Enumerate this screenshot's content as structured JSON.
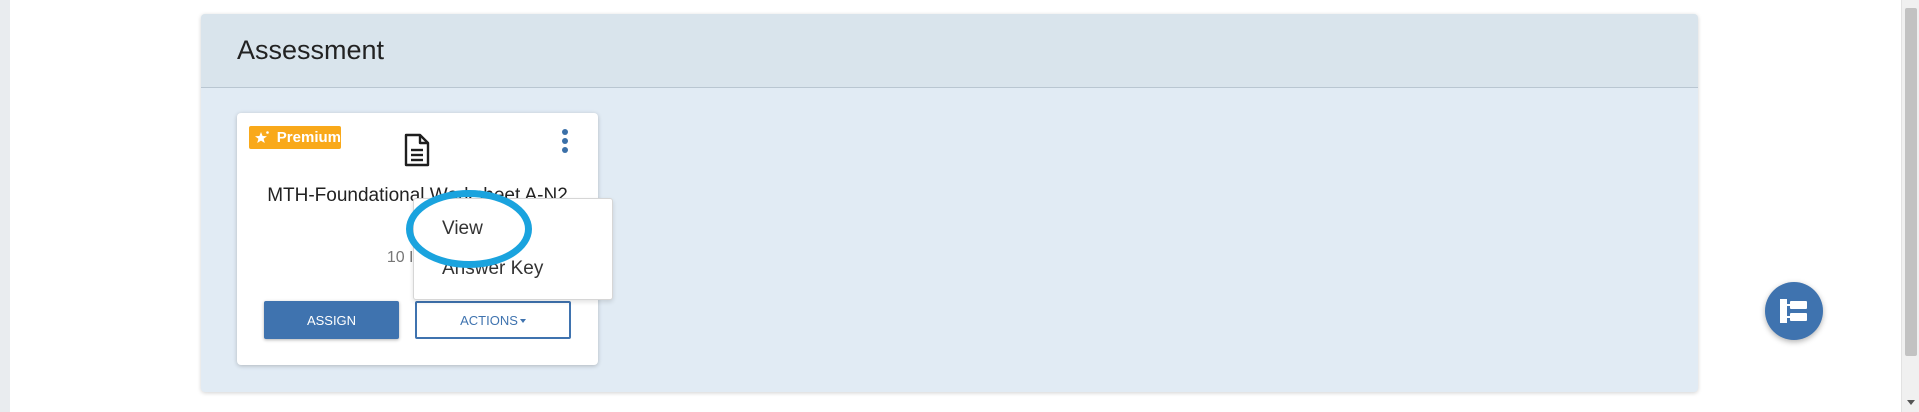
{
  "panel": {
    "title": "Assessment"
  },
  "card": {
    "badge": "Premium",
    "title": "MTH-Foundational Worksheet A-N2",
    "count": "10 Items",
    "assign_label": "ASSIGN",
    "actions_label": "ACTIONS"
  },
  "dropdown": {
    "items": [
      "View",
      "Answer Key"
    ]
  },
  "colors": {
    "accent": "#3f73af",
    "premium": "#f9a91a",
    "highlight": "#1aa3de",
    "panel_bg": "#e1ebf4"
  },
  "icons": {
    "badge": "star-icon",
    "card": "document-icon",
    "menu": "kebab-menu-icon",
    "fab": "sitemap-icon"
  }
}
